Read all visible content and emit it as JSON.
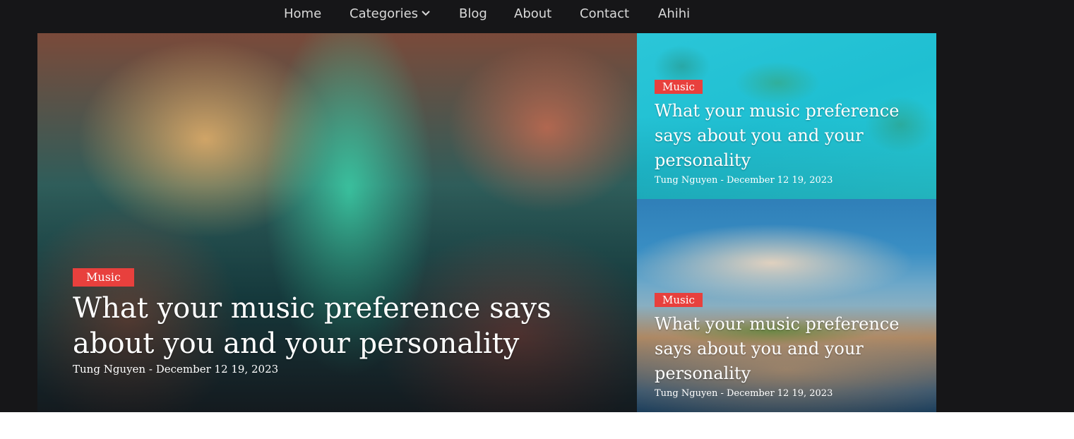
{
  "nav": {
    "items": [
      "Home",
      "Categories",
      "Blog",
      "About",
      "Contact",
      "Ahihi"
    ]
  },
  "featured": {
    "main": {
      "category": "Music",
      "title": "What your music preference says about you and your personality",
      "meta": "Tung Nguyen - December 12 19, 2023"
    },
    "side_top": {
      "category": "Music",
      "title": "What your music preference says about you and your personality",
      "meta": "Tung Nguyen - December 12 19, 2023"
    },
    "side_bottom": {
      "category": "Music",
      "title": "What your music preference says about you and your personality",
      "meta": "Tung Nguyen - December 12 19, 2023"
    }
  },
  "colors": {
    "header_bg": "#161618",
    "badge_bg": "#e8403d",
    "nav_text": "#d9d9d9"
  },
  "icons": {
    "categories_dropdown": "chevron-down-icon"
  }
}
